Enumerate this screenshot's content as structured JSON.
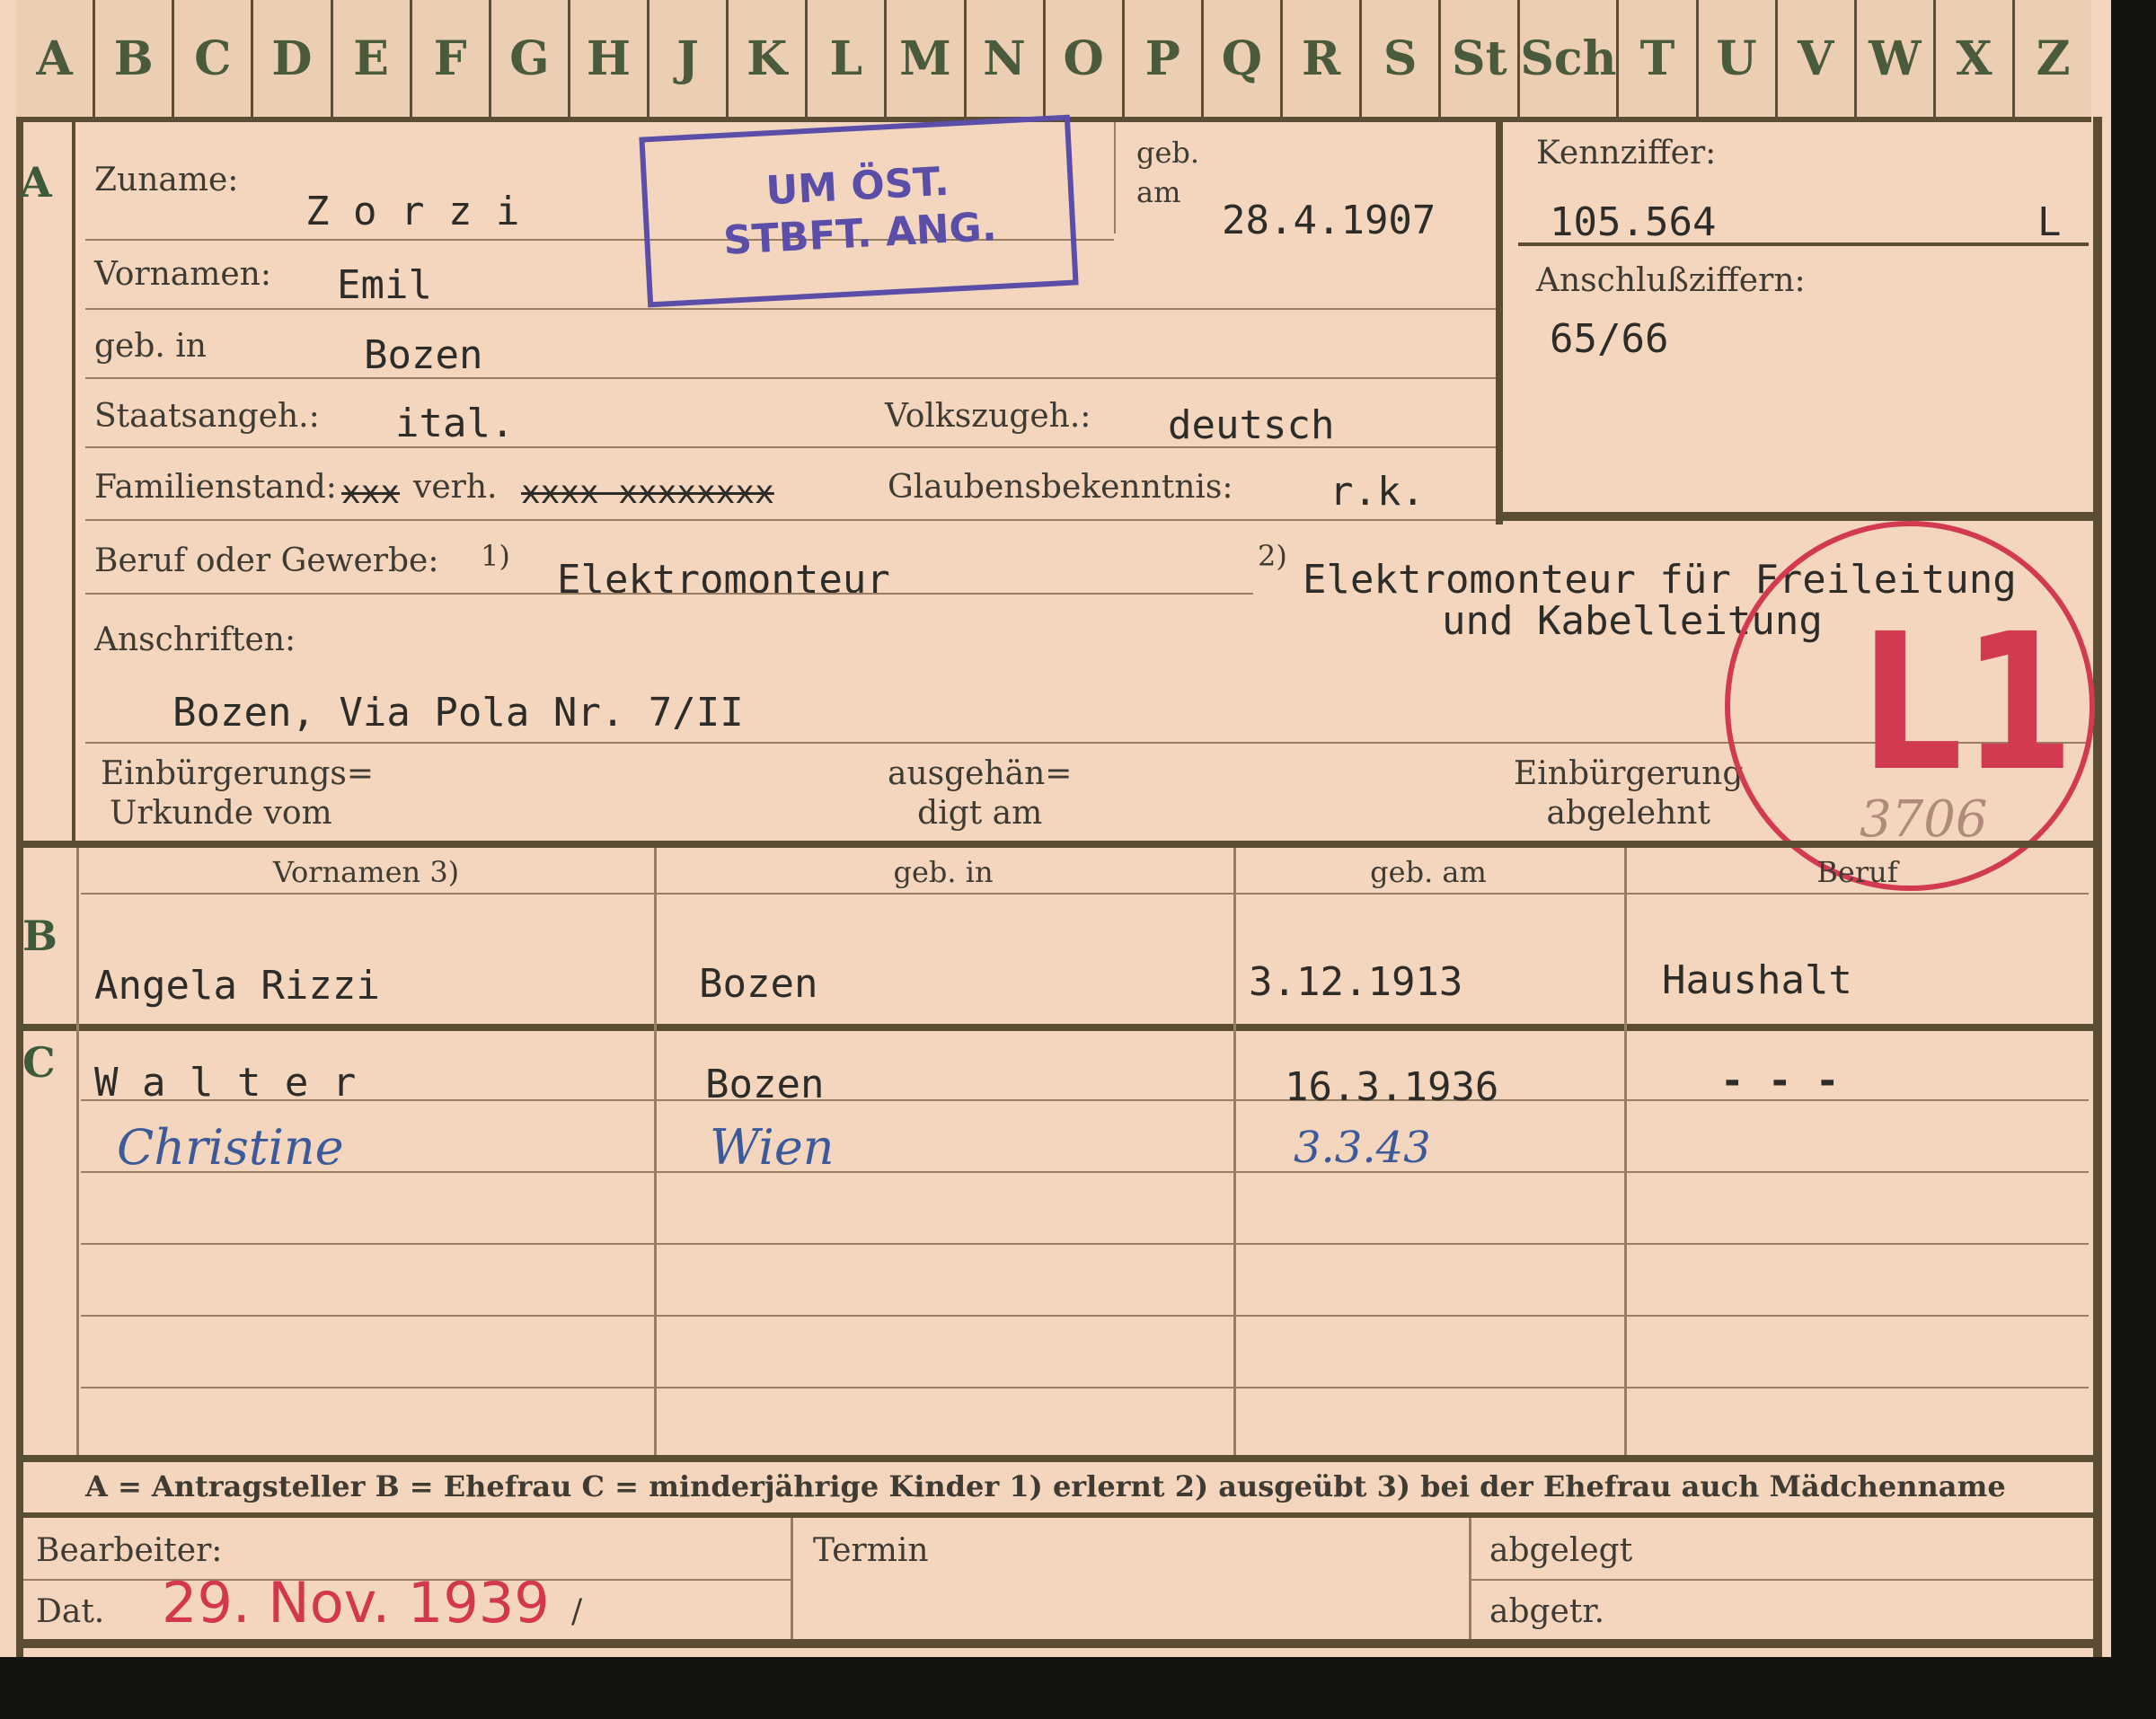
{
  "alphabet": [
    "A",
    "B",
    "C",
    "D",
    "E",
    "F",
    "G",
    "H",
    "J",
    "K",
    "L",
    "M",
    "N",
    "O",
    "P",
    "Q",
    "R",
    "S",
    "St",
    "Sch",
    "T",
    "U",
    "V",
    "W",
    "X",
    "Z"
  ],
  "section_a": {
    "letter": "A",
    "zuname_label": "Zuname:",
    "zuname": "Z o r z i",
    "geb_am_label": "geb. am",
    "geb_am": "28.4.1907",
    "vornamen_label": "Vornamen:",
    "vornamen": "Emil",
    "geb_in_label": "geb. in",
    "geb_in": "Bozen",
    "staatsangeh_label": "Staatsangeh.:",
    "staatsangeh": "ital.",
    "volkszugeh_label": "Volkszugeh.:",
    "volkszugeh": "deutsch",
    "familienstand_label": "Familienstand:",
    "familienstand_struck_1": "xxx",
    "familienstand_value": "verh.",
    "familienstand_struck_2": "xxxx xxxxxxxx",
    "glaubensbekenntnis_label": "Glaubensbekenntnis:",
    "glaubensbekenntnis": "r.k.",
    "beruf_label": "Beruf oder Gewerbe:",
    "beruf_note_1": "1)",
    "beruf_erlernt": "Elektromonteur",
    "beruf_note_2": "2)",
    "beruf_ausgeuebt_1": "Elektromonteur für Freileitung",
    "beruf_ausgeuebt_2": "und Kabelleitung",
    "anschriften_label": "Anschriften:",
    "anschrift": "Bozen, Via Pola Nr. 7/II",
    "urkunde_label_1": "Einbürgerungs=",
    "urkunde_label_2": "Urkunde vom",
    "ausgehaendigt_label_1": "ausgehän=",
    "ausgehaendigt_label_2": "digt am",
    "abgelehnt_label_1": "Einbürgerung",
    "abgelehnt_label_2": "abgelehnt"
  },
  "kennziffer": {
    "label": "Kennziffer:",
    "value": "105.564",
    "suffix": "L",
    "anschluss_label": "Anschlußziffern:",
    "anschluss": "65/66"
  },
  "stamp_box": {
    "line1": "UM ÖST.",
    "line2": "STBFT. ANG."
  },
  "stamp_circle": {
    "text": "L1",
    "number": "3706"
  },
  "section_b": {
    "letter": "B",
    "headers": [
      "Vornamen 3)",
      "geb. in",
      "geb. am",
      "Beruf"
    ],
    "row": [
      "Angela Rizzi",
      "Bozen",
      "3.12.1913",
      "Haushalt"
    ]
  },
  "section_c": {
    "letter": "C",
    "children": [
      {
        "name": "W a l t e r",
        "place": "Bozen",
        "date": "16.3.1936",
        "beruf": "- - -"
      },
      {
        "name": "Christine",
        "place": "Wien",
        "date": "3.3.43",
        "beruf": ""
      }
    ]
  },
  "legend": "A = Antragsteller   B = Ehefrau   C = minderjährige Kinder   1) erlernt   2) ausgeübt   3) bei der Ehefrau auch Mädchenname",
  "footer": {
    "bearbeiter_label": "Bearbeiter:",
    "dat_label": "Dat.",
    "date": "29. Nov. 1939",
    "slash": "/",
    "termin_label": "Termin",
    "abgelegt_label": "abgelegt",
    "abgetr_label": "abgetr."
  }
}
